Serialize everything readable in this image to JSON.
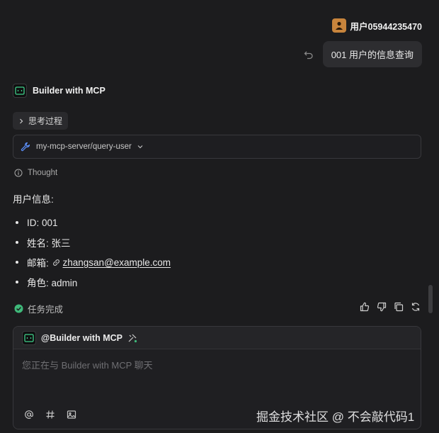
{
  "user": {
    "name": "用户05944235470"
  },
  "message": {
    "text": "001 用户的信息查询"
  },
  "assistant": {
    "name": "Builder with MCP",
    "thinking_label": "思考过程",
    "tool_call": "my-mcp-server/query-user",
    "thought_label": "Thought",
    "answer_title": "用户信息:",
    "items": [
      {
        "text": "ID: 001"
      },
      {
        "text": "姓名: 张三"
      },
      {
        "prefix": "邮箱: ",
        "link": "zhangsan@example.com"
      },
      {
        "text": "角色: admin"
      }
    ],
    "status": "任务完成"
  },
  "composer": {
    "mention": "@Builder with MCP",
    "placeholder": "您正在与 Builder with MCP 聊天"
  },
  "watermark": "掘金技术社区 @ 不会敲代码1",
  "colors": {
    "status_green": "#3fb97a",
    "user_avatar": "#c8843c",
    "tool_icon": "#5b8ff9"
  }
}
